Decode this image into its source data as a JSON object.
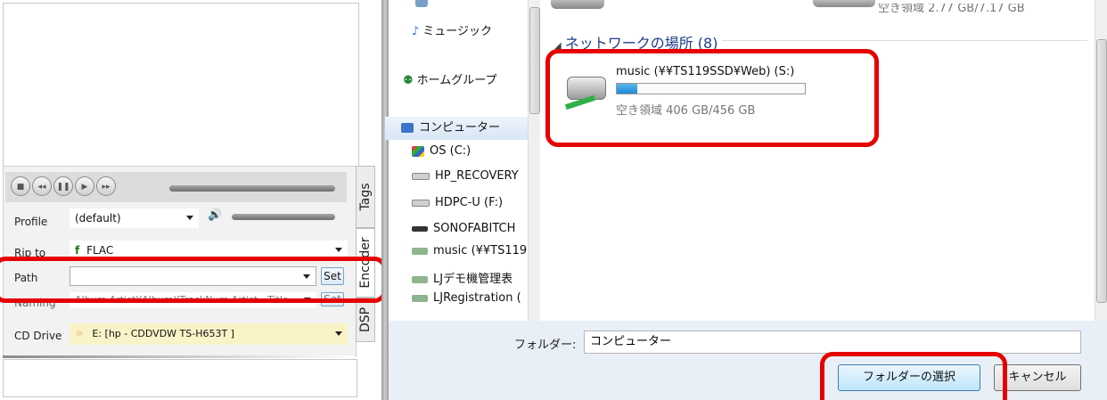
{
  "left_app": {
    "tabs": [
      "Tags",
      "Encoder",
      "DSP"
    ],
    "transport": {
      "stop": "■",
      "prev": "◂◂",
      "pause": "❚❚",
      "play": "▶",
      "next": "▸▸"
    },
    "volume_icon": "speaker-icon",
    "fields": {
      "profile": {
        "label": "Profile",
        "value": "(default)"
      },
      "rip_to": {
        "label": "Rip to",
        "value": "FLAC"
      },
      "path": {
        "label": "Path",
        "value": "",
        "set_label": "Set"
      },
      "naming": {
        "label": "Naming",
        "value": "Album Artist¥Album¥TrackNum Artist - Title",
        "set_label": "Set"
      },
      "cd_drive": {
        "label": "CD Drive",
        "value": "E:  [hp      - CDDVDW TS-H653T ]"
      }
    }
  },
  "dialog": {
    "top_free_text": "空き領域 2.77 GB/7.17 GB",
    "nav": {
      "music": "ミュージック",
      "homegroup": "ホームグループ",
      "computer": "コンピューター",
      "drives": [
        "OS (C:)",
        "HP_RECOVERY",
        "HDPC-U (F:)",
        "SONOFABITCH",
        "music (¥¥TS119",
        "LJデモ機管理表",
        "LJRegistration ("
      ]
    },
    "network_header": "ネットワークの場所 (8)",
    "network_item": {
      "name": "music (¥¥TS119SSD¥Web) (S:)",
      "free": "空き領域 406 GB/456 GB",
      "usage": 0.11
    },
    "folder_label": "フォルダー:",
    "folder_value": "コンピューター",
    "select_button": "フォルダーの選択",
    "cancel_button": "キャンセル"
  },
  "colors": {
    "highlight": "#e60000",
    "drive_bar": "#1e8ad6",
    "panel_bg": "#e9eff7"
  }
}
